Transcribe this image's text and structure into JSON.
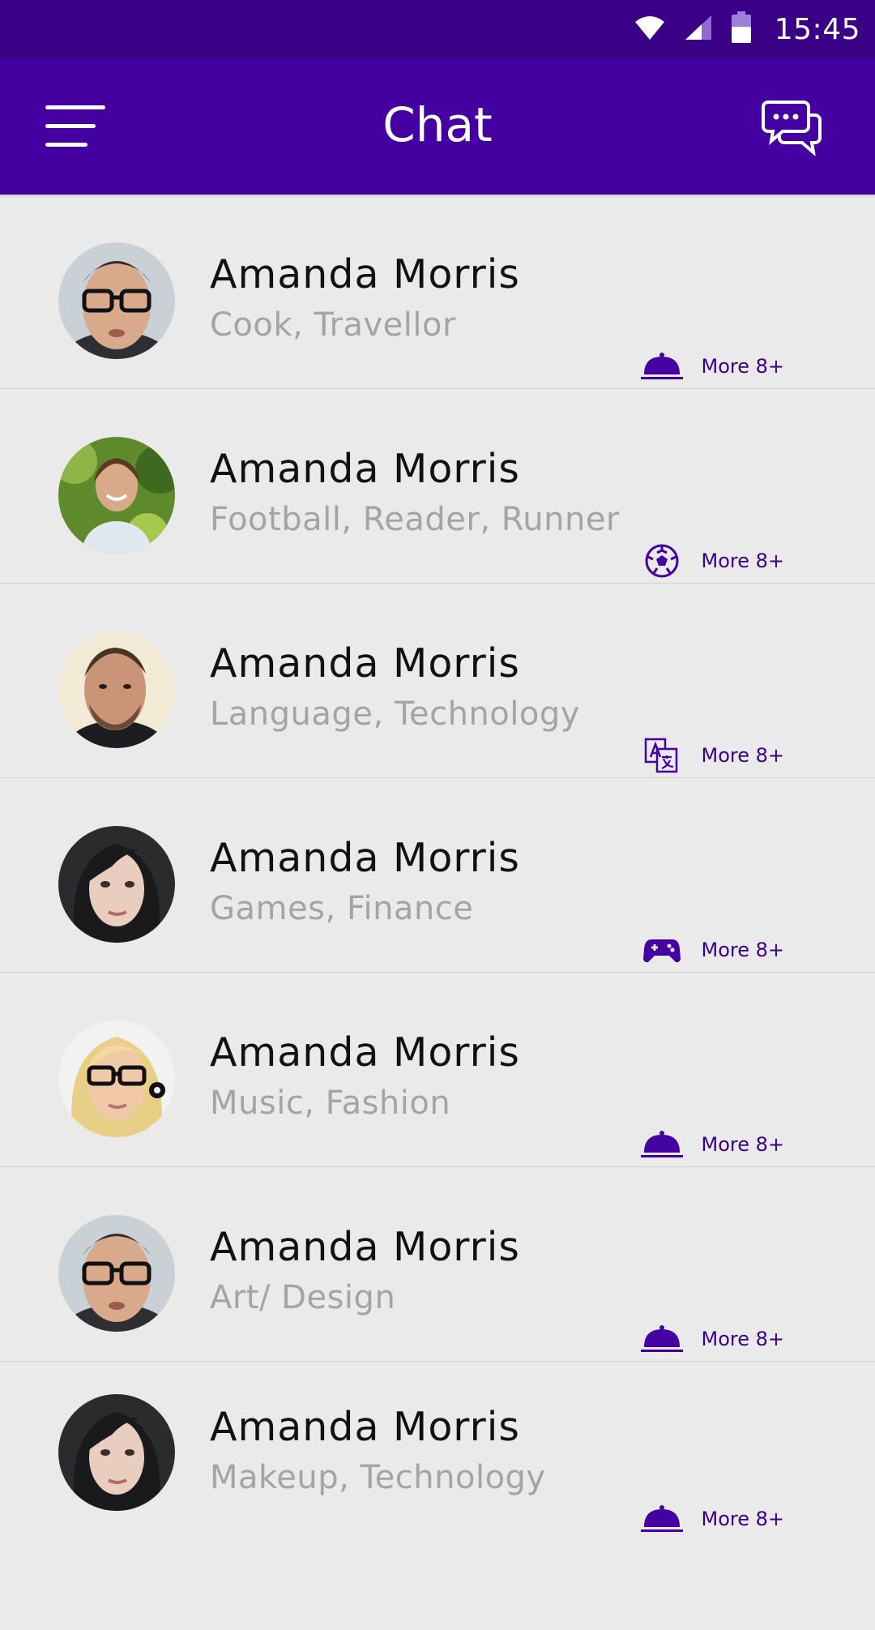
{
  "status_bar": {
    "time": "15:45",
    "icons": [
      "wifi-icon",
      "signal-icon",
      "battery-icon"
    ],
    "background": "#3a0086"
  },
  "app_bar": {
    "title": "Chat",
    "menu_icon": "hamburger-menu-icon",
    "action_icon": "chat-bubbles-icon",
    "background": "#4400a0"
  },
  "colors": {
    "accent": "#4400a0",
    "name_text": "#111111",
    "tag_text": "#a4a4a8",
    "list_background": "#eaeaea"
  },
  "contacts": [
    {
      "name": "Amanda Morris",
      "tags": "Cook, Travellor",
      "interest_icon": "food-cloche-icon",
      "more": "More 8+",
      "avatar": "avatar-man-glasses"
    },
    {
      "name": "Amanda Morris",
      "tags": "Football, Reader, Runner",
      "interest_icon": "soccer-ball-icon",
      "more": "More 8+",
      "avatar": "avatar-woman-outdoor"
    },
    {
      "name": "Amanda Morris",
      "tags": "Language, Technology",
      "interest_icon": "translate-icon",
      "more": "More 8+",
      "avatar": "avatar-man-beard"
    },
    {
      "name": "Amanda Morris",
      "tags": "Games, Finance",
      "interest_icon": "gamepad-icon",
      "more": "More 8+",
      "avatar": "avatar-woman-dark-hair"
    },
    {
      "name": "Amanda Morris",
      "tags": "Music, Fashion",
      "interest_icon": "food-cloche-icon",
      "more": "More 8+",
      "avatar": "avatar-woman-blonde-glasses"
    },
    {
      "name": "Amanda Morris",
      "tags": "Art/ Design",
      "interest_icon": "food-cloche-icon",
      "more": "More 8+",
      "avatar": "avatar-man-glasses"
    },
    {
      "name": "Amanda Morris",
      "tags": "Makeup, Technology",
      "interest_icon": "food-cloche-icon",
      "more": "More 8+",
      "avatar": "avatar-woman-dark-hair"
    }
  ]
}
